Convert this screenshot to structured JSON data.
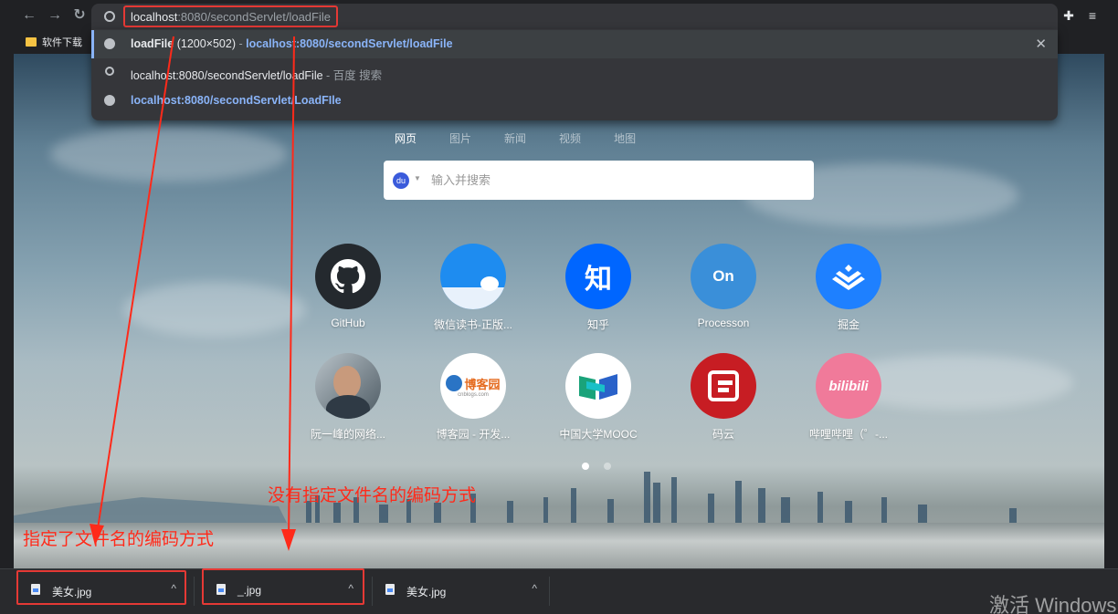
{
  "browser": {
    "address": {
      "host": "localhost",
      "rest": ":8080/secondServlet/loadFile"
    },
    "bookmark": "软件下载",
    "icons": {
      "back": "back-arrow-icon",
      "forward": "forward-arrow-icon",
      "reload": "reload-icon",
      "site": "globe-icon",
      "extensions": "puzzle-icon",
      "media": "playlist-icon"
    }
  },
  "suggestions": {
    "row1": {
      "title": "loadFile",
      "meta": " (1200×502)",
      "sep": " - ",
      "url": "localhost:8080/secondServlet/loadFile"
    },
    "row2": {
      "query": "localhost:8080/secondServlet/loadFile",
      "suffix": " - 百度 搜索"
    },
    "row3": {
      "url": "localhost:8080/secondServlet/LoadFIle"
    }
  },
  "newtab": {
    "tabs": [
      "网页",
      "图片",
      "新闻",
      "视频",
      "地图"
    ],
    "search_placeholder": "输入并搜索",
    "engine_icon": "du",
    "shortcuts": [
      {
        "label": "GitHub",
        "glyph": "",
        "color": "#24292e"
      },
      {
        "label": "微信读书-正版...",
        "glyph": "",
        "color": "#1e8cf0"
      },
      {
        "label": "知乎",
        "glyph": "知",
        "color": "#0066ff"
      },
      {
        "label": "Processon",
        "glyph": "On",
        "color": "#3a8fd9"
      },
      {
        "label": "掘金",
        "glyph": "",
        "color": "#1e80ff"
      },
      {
        "label": "阮一峰的网络...",
        "glyph": "",
        "color": "#5b6770"
      },
      {
        "label": "博客园 - 开发...",
        "glyph": "博客园",
        "color": "#ffffff"
      },
      {
        "label": "中国大学MOOC",
        "glyph": "",
        "color": "#ffffff"
      },
      {
        "label": "码云",
        "glyph": "",
        "color": "#c71d23"
      },
      {
        "label": "哔哩哔哩（゜-...",
        "glyph": "bilibili",
        "color": "#f07a9a"
      }
    ],
    "blog_sub": "cnblogs.com"
  },
  "annotations": {
    "right": "没有指定文件名的编码方式",
    "left": "指定了文件名的编码方式"
  },
  "downloads": [
    {
      "name": "美女.jpg"
    },
    {
      "name": "_.jpg"
    },
    {
      "name": "美女.jpg"
    }
  ],
  "watermark": "激活 Windows"
}
